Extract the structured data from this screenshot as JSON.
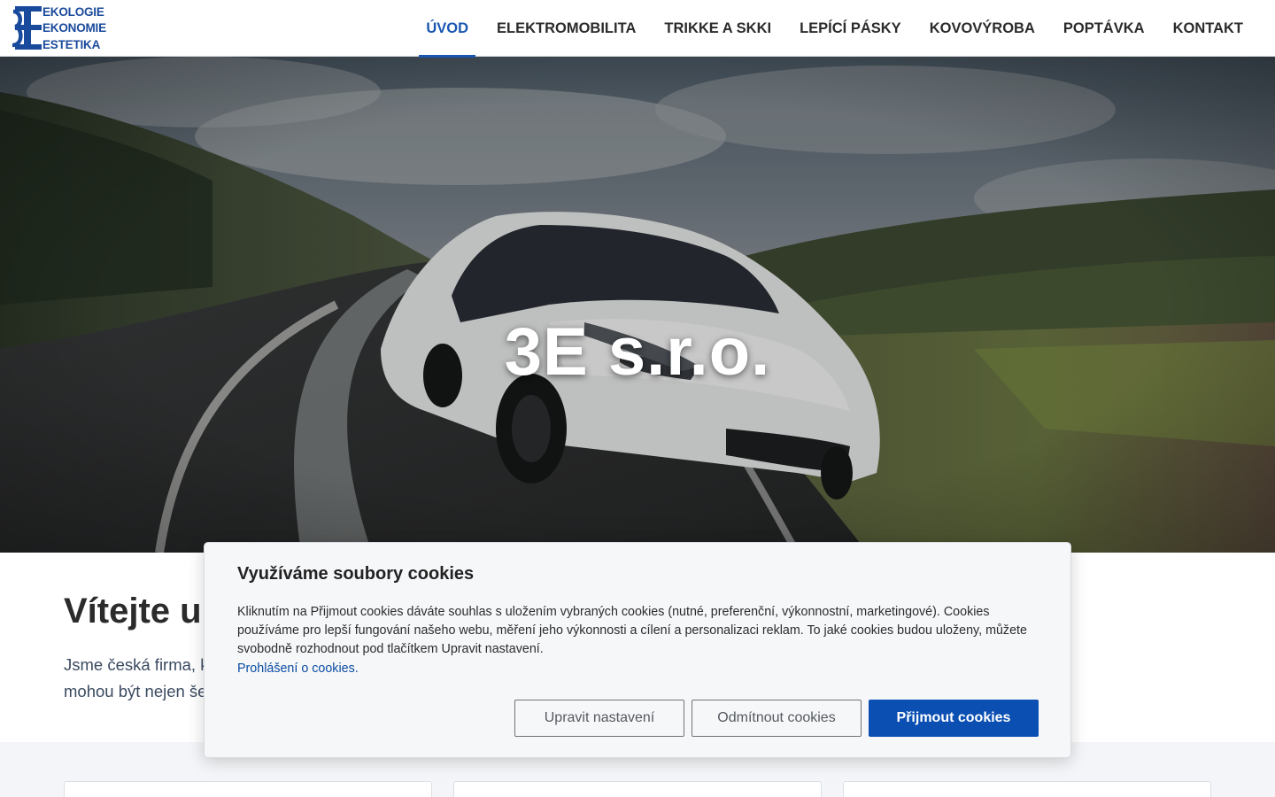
{
  "logo": {
    "lines": [
      "EKOLOGIE",
      "EKONOMIE",
      "ESTETIKA"
    ],
    "color": "#1a4a9c"
  },
  "nav": {
    "items": [
      {
        "label": "ÚVOD",
        "active": true
      },
      {
        "label": "ELEKTROMOBILITA"
      },
      {
        "label": "TRIKKE A SKKI"
      },
      {
        "label": "LEPÍCÍ PÁSKY"
      },
      {
        "label": "KOVOVÝROBA"
      },
      {
        "label": "POPTÁVKA"
      },
      {
        "label": "KONTAKT"
      }
    ],
    "active_color": "#1a56b0"
  },
  "hero": {
    "title": "3E s.r.o.",
    "image": "white car driving on a curved road, motion blur"
  },
  "main": {
    "welcome_partial": "Vítejte u",
    "intro_line1_partial": "Jsme česká firma, k",
    "intro_line2_partial": "mohou být nejen še"
  },
  "cookie": {
    "title": "Využíváme soubory cookies",
    "text": "Kliknutím na Přijmout cookies dáváte souhlas s uložením vybraných cookies (nutné, preferenční, výkonnostní, marketingové). Cookies používáme pro lepší fungování našeho webu, měření jeho výkonnosti a cílení a personalizaci reklam. To jaké cookies budou uloženy, můžete svobodně rozhodnout pod tlačítkem Upravit nastavení.",
    "link": "Prohlášení o cookies.",
    "buttons": {
      "settings": "Upravit nastavení",
      "reject": "Odmítnout cookies",
      "accept": "Přijmout cookies"
    },
    "accept_color": "#0b4fb3"
  }
}
